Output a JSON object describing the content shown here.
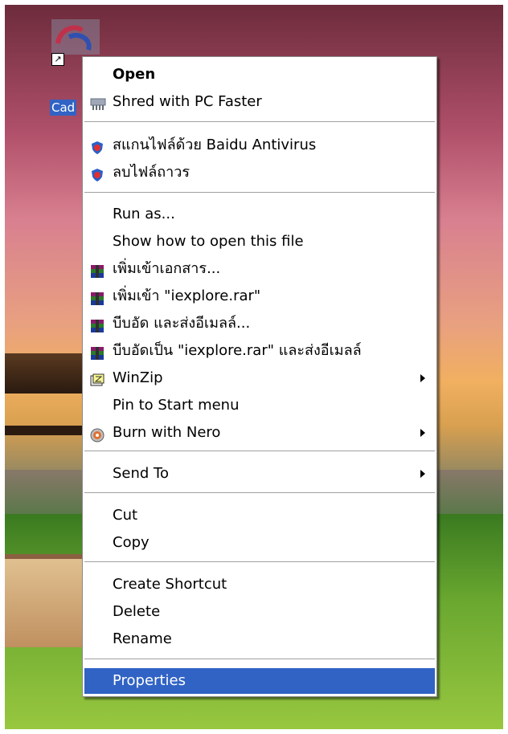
{
  "desktop": {
    "icon_label": "Cad"
  },
  "menu": {
    "items": [
      {
        "label": "Open",
        "icon": "none"
      },
      {
        "label": "Shred with PC Faster",
        "icon": "shredder-icon"
      },
      {
        "label": "สแกนไฟล์ด้วย Baidu Antivirus",
        "icon": "baidu-shield-icon"
      },
      {
        "label": "ลบไฟล์ถาวร",
        "icon": "baidu-shield-icon"
      },
      {
        "label": "Run as...",
        "icon": "none"
      },
      {
        "label": "Show how to open this file",
        "icon": "none"
      },
      {
        "label": "เพิ่มเข้าเอกสาร...",
        "icon": "winrar-icon"
      },
      {
        "label": "เพิ่มเข้า \"iexplore.rar\"",
        "icon": "winrar-icon"
      },
      {
        "label": "บีบอัด และส่งอีเมลล์...",
        "icon": "winrar-icon"
      },
      {
        "label": "บีบอัดเป็น \"iexplore.rar\" และส่งอีเมลล์",
        "icon": "winrar-icon"
      },
      {
        "label": "WinZip",
        "icon": "winzip-icon",
        "submenu": true
      },
      {
        "label": "Pin to Start menu",
        "icon": "none"
      },
      {
        "label": "Burn with Nero",
        "icon": "nero-icon",
        "submenu": true
      },
      {
        "label": "Send To",
        "icon": "none",
        "submenu": true
      },
      {
        "label": "Cut",
        "icon": "none"
      },
      {
        "label": "Copy",
        "icon": "none"
      },
      {
        "label": "Create Shortcut",
        "icon": "none"
      },
      {
        "label": "Delete",
        "icon": "none"
      },
      {
        "label": "Rename",
        "icon": "none"
      },
      {
        "label": "Properties",
        "icon": "none",
        "selected": true
      }
    ]
  },
  "colors": {
    "selection": "#3163c5",
    "menu_bg": "#ffffff"
  }
}
